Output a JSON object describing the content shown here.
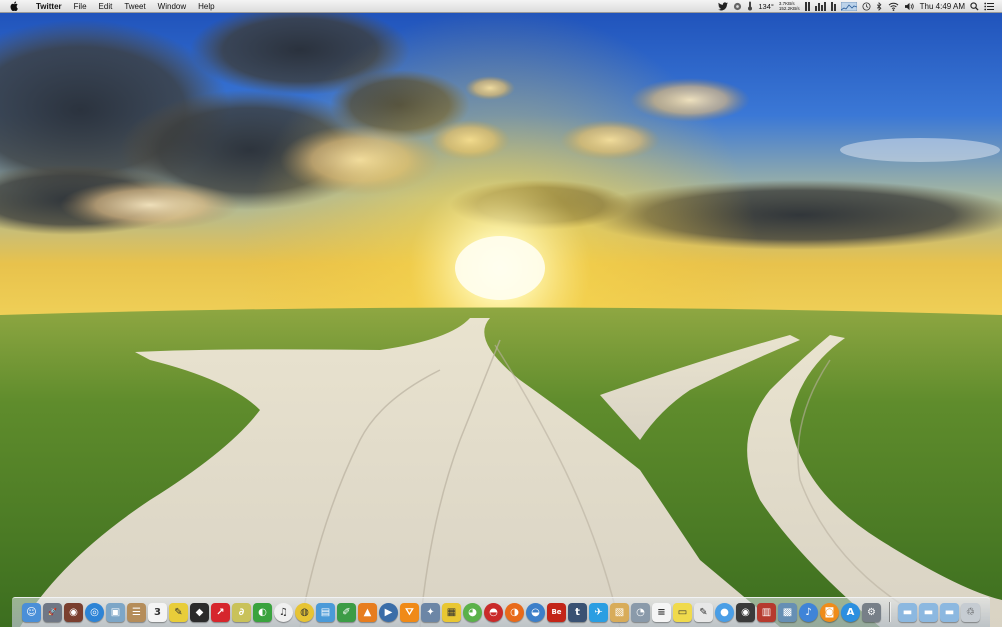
{
  "menubar": {
    "apple_glyph": "",
    "app_name": "Twitter",
    "menus": [
      "File",
      "Edit",
      "Tweet",
      "Window",
      "Help"
    ],
    "status": {
      "temperature": "134°",
      "network_up": "3.7KB/s",
      "network_down": "152.2KB/s",
      "clock": "Thu 4:49 AM"
    }
  },
  "dock": {
    "apps": [
      {
        "name": "finder",
        "bg": "#4a8fd8",
        "glyph": "☺"
      },
      {
        "name": "launchpad",
        "bg": "#6f7785",
        "glyph": "🚀"
      },
      {
        "name": "photo-booth",
        "bg": "#7a3f2f",
        "glyph": "◉"
      },
      {
        "name": "safari",
        "bg": "#2d84d6",
        "glyph": "◎"
      },
      {
        "name": "preview",
        "bg": "#7da6c7",
        "glyph": "▣"
      },
      {
        "name": "contacts",
        "bg": "#b58d5a",
        "glyph": "☰"
      },
      {
        "name": "calendar",
        "bg": "#f4f4f4",
        "glyph": "3"
      },
      {
        "name": "notes",
        "bg": "#e8cd3a",
        "glyph": "✎"
      },
      {
        "name": "silhouette",
        "bg": "#2b2b2b",
        "glyph": "◆"
      },
      {
        "name": "pin-app",
        "bg": "#d6262d",
        "glyph": "↗"
      },
      {
        "name": "paperclip",
        "bg": "#c9c25a",
        "glyph": "∂"
      },
      {
        "name": "evernote",
        "bg": "#3aa33e",
        "glyph": "◐"
      },
      {
        "name": "itunes-radio",
        "bg": "#f0f0f0",
        "glyph": "♫"
      },
      {
        "name": "chrome",
        "bg": "#e7c434",
        "glyph": "◍"
      },
      {
        "name": "books",
        "bg": "#4b9ad8",
        "glyph": "▤"
      },
      {
        "name": "pencil",
        "bg": "#3c9c46",
        "glyph": "✐"
      },
      {
        "name": "vlc-cone",
        "bg": "#e77d1f",
        "glyph": "▲"
      },
      {
        "name": "quicktime",
        "bg": "#3a6da8",
        "glyph": "▶"
      },
      {
        "name": "vlc",
        "bg": "#f08a17",
        "glyph": "⛛"
      },
      {
        "name": "satellite",
        "bg": "#6c86a6",
        "glyph": "✦"
      },
      {
        "name": "sponge",
        "bg": "#e9c733",
        "glyph": "▦"
      },
      {
        "name": "colorful-disc",
        "bg": "#5bb14a",
        "glyph": "◕"
      },
      {
        "name": "pokeball",
        "bg": "#c92a2a",
        "glyph": "◓"
      },
      {
        "name": "firefox",
        "bg": "#e86a1a",
        "glyph": "◑"
      },
      {
        "name": "globe",
        "bg": "#3c7fc9",
        "glyph": "◒"
      },
      {
        "name": "behance",
        "bg": "#c32518",
        "glyph": "Be"
      },
      {
        "name": "tumblr",
        "bg": "#3a5273",
        "glyph": "t"
      },
      {
        "name": "twitter",
        "bg": "#2b9ee2",
        "glyph": "✈"
      },
      {
        "name": "package",
        "bg": "#d8ac5a",
        "glyph": "▧"
      },
      {
        "name": "disk-utility",
        "bg": "#8a9aaa",
        "glyph": "◔"
      },
      {
        "name": "textedit",
        "bg": "#f5f5f5",
        "glyph": "≡"
      },
      {
        "name": "stickies",
        "bg": "#f0da4c",
        "glyph": "▭"
      },
      {
        "name": "textwrangler",
        "bg": "#e7e7e7",
        "glyph": "✎"
      },
      {
        "name": "messages",
        "bg": "#4a9ee6",
        "glyph": "●"
      },
      {
        "name": "camera",
        "bg": "#3a3a3a",
        "glyph": "◉"
      },
      {
        "name": "photo-stack",
        "bg": "#b63a2e",
        "glyph": "▥"
      },
      {
        "name": "photos",
        "bg": "#668fb4",
        "glyph": "▩"
      },
      {
        "name": "itunes",
        "bg": "#3f84d8",
        "glyph": "♪"
      },
      {
        "name": "ibooks",
        "bg": "#ef8c1a",
        "glyph": "◙"
      },
      {
        "name": "app-store",
        "bg": "#2c8fe0",
        "glyph": "A"
      },
      {
        "name": "system-preferences",
        "bg": "#777f88",
        "glyph": "⚙"
      }
    ],
    "stacks": [
      {
        "name": "applications-folder",
        "bg": "#8cb8e0",
        "glyph": "▬"
      },
      {
        "name": "documents-folder",
        "bg": "#8cb8e0",
        "glyph": "▬"
      },
      {
        "name": "downloads-folder",
        "bg": "#8cb8e0",
        "glyph": "▬"
      },
      {
        "name": "trash",
        "bg": "#c6ccd2",
        "glyph": "♲"
      }
    ]
  }
}
